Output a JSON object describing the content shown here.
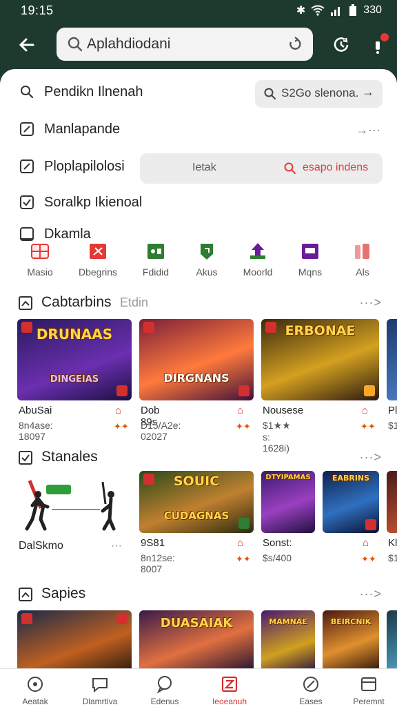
{
  "status": {
    "time": "19:15",
    "battery": "330"
  },
  "topbar": {
    "search_value": "Aplahdiodani"
  },
  "rows": [
    {
      "label": "Pendikn Ilnenah"
    },
    {
      "label": "Manlapande"
    },
    {
      "label": "Ploplapilolosi"
    },
    {
      "label": "Soralkp Ikienoal"
    },
    {
      "label": "Dkamla"
    }
  ],
  "pill1": {
    "text": "S2Go slenona.",
    "arrow": "→"
  },
  "row2_more": "→···",
  "pill2": {
    "left": "Ietak",
    "right": "esapo indens"
  },
  "categories": [
    {
      "label": "Masio",
      "color": "#e53935"
    },
    {
      "label": "Dbegrins",
      "color": "#e53935"
    },
    {
      "label": "Fdidid",
      "color": "#2e7d32"
    },
    {
      "label": "Akus",
      "color": "#2e7d32"
    },
    {
      "label": "Moorld",
      "color": "#6a1b9a"
    },
    {
      "label": "Mqns",
      "color": "#6a1b9a"
    },
    {
      "label": "Als",
      "color": "#e57373"
    }
  ],
  "sections": [
    {
      "title": "Cabtarbins",
      "subtitle": "Etdin",
      "more": "···>"
    },
    {
      "title": "Stanales",
      "more": "···>"
    },
    {
      "title": "Sapies",
      "more": "···>"
    }
  ],
  "games1": [
    {
      "img_title": "DRUNAAS",
      "img_sub": "DINGEIAS",
      "name": "AbuSai",
      "meta": "8n4ase: 18097",
      "theme": [
        "#2a1a5e",
        "#6b2fb0"
      ]
    },
    {
      "img_title": "DIRGNANS",
      "img_sub": "",
      "name": "Dob 89s",
      "meta": "D15/A2e: 02027",
      "theme": [
        "#7a1f3a",
        "#ff7a3c"
      ]
    },
    {
      "img_title": "ERBONAE",
      "img_sub": "",
      "name": "Nousese",
      "meta": "$1★★ s: 1628i)",
      "theme": [
        "#3a2a10",
        "#d4a020"
      ]
    },
    {
      "img_title": "",
      "img_sub": "",
      "name": "Pl",
      "meta": "$1",
      "theme": [
        "#1a3a6e",
        "#4a7ac0"
      ]
    }
  ],
  "stanales_label": "DalSkmo",
  "stanales_more": "···",
  "games2": [
    {
      "img_title": "SOUIC",
      "img_sub": "CUDAGNAS",
      "name": "9S81",
      "meta": "8n12se: 8007",
      "theme": [
        "#2a4a1a",
        "#c08030"
      ]
    },
    {
      "img_title": "DTYIPAMAS",
      "img_sub": "",
      "name": "Sonst:",
      "meta": "$s/400",
      "theme": [
        "#3a1a6e",
        "#9a40c0"
      ]
    },
    {
      "img_title": "EABRINS",
      "img_sub": "",
      "name": "",
      "meta": "",
      "theme": [
        "#10204a",
        "#3070c0"
      ]
    },
    {
      "img_title": "",
      "img_sub": "",
      "name": "Kl",
      "meta": "$1",
      "theme": [
        "#4a1a1a",
        "#c05030"
      ]
    }
  ],
  "games3": [
    {
      "img_title": "",
      "theme": [
        "#1a2a4a",
        "#c06020"
      ]
    },
    {
      "img_title": "DUASAIAK",
      "theme": [
        "#3a1a4a",
        "#e07040"
      ]
    },
    {
      "img_title": "MAMNAE",
      "theme": [
        "#4a1a6e",
        "#d0a020"
      ]
    },
    {
      "img_title": "BEIRCNIK",
      "theme": [
        "#4a1a10",
        "#e09030"
      ]
    },
    {
      "img_title": "",
      "theme": [
        "#1a3a4a",
        "#50a0c0"
      ]
    }
  ],
  "nav": [
    {
      "label": "Aeatak"
    },
    {
      "label": "Dlamrtiva"
    },
    {
      "label": "Edenus"
    },
    {
      "label": "Ieoeanuh"
    },
    {
      "label": "Eases"
    },
    {
      "label": "Peremnt"
    }
  ]
}
